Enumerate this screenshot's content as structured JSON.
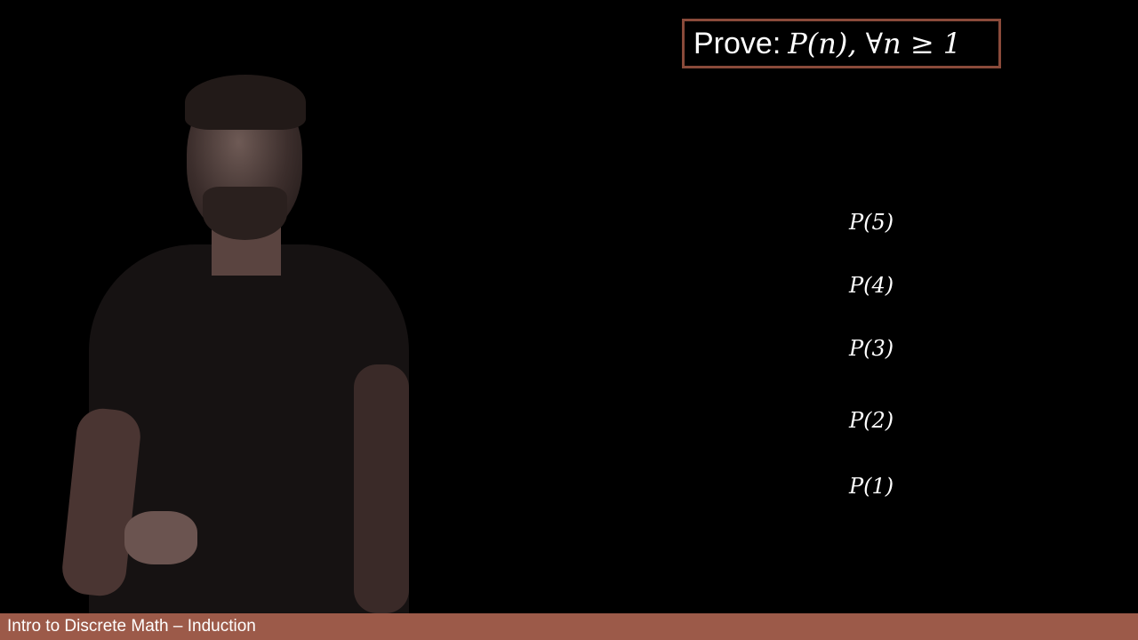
{
  "header": {
    "prove_label": "Prove:",
    "formula": "P(n), ∀n ≥ 1"
  },
  "statements": [
    "P(5)",
    "P(4)",
    "P(3)",
    "P(2)",
    "P(1)"
  ],
  "footer": {
    "title": "Intro to Discrete Math – Induction"
  },
  "colors": {
    "background": "#000000",
    "accent": "#9c5a49",
    "box_border": "#8a4a3a",
    "text": "#ffffff"
  }
}
